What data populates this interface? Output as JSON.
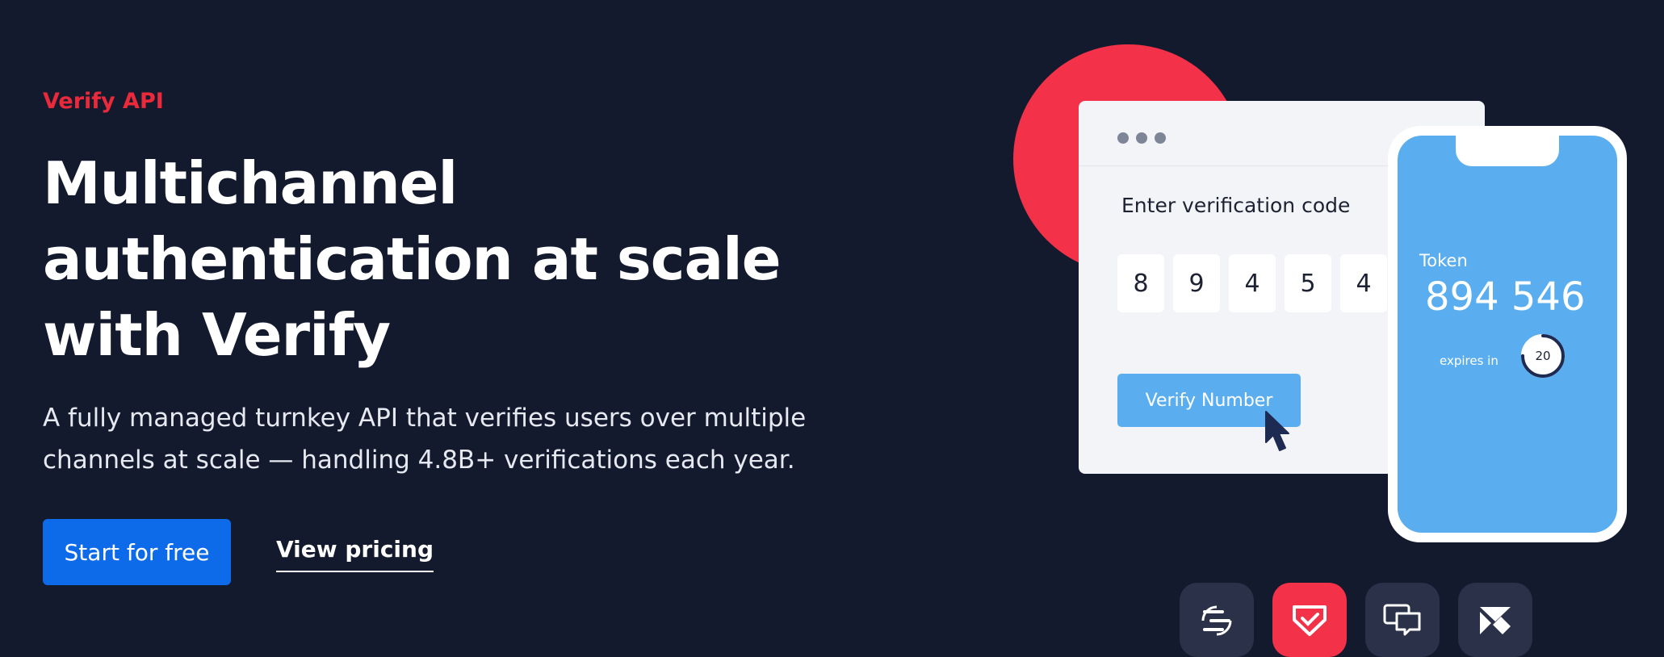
{
  "hero": {
    "eyebrow": "Verify API",
    "headline": "Multichannel authentication at scale with Verify",
    "subhead": "A fully managed turnkey API that verifies users over multiple channels at scale — handling 4.8B+ verifications each year.",
    "primary_cta": "Start for free",
    "secondary_cta": "View pricing"
  },
  "illustration": {
    "card_label": "Enter verification code",
    "digits": [
      "8",
      "9",
      "4",
      "5",
      "4"
    ],
    "verify_button": "Verify Number",
    "phone": {
      "token_label": "Token",
      "token_value": "894 546",
      "expires_label": "expires in",
      "timer_value": "20",
      "timer_progress": 0.75
    }
  },
  "channel_icons": [
    "silent-auth-icon",
    "verify-shield-icon",
    "chat-icon",
    "email-icon"
  ],
  "colors": {
    "background": "#141a2e",
    "accent_red": "#f33249",
    "eyebrow_red": "#ea2a3a",
    "primary_blue": "#0d6bea",
    "light_blue": "#5aaef0"
  }
}
